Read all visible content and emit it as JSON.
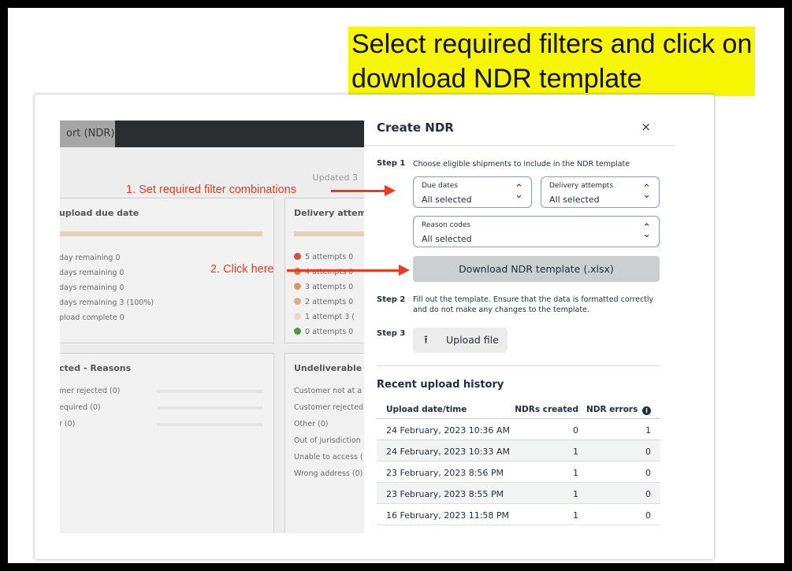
{
  "callout": {
    "line1": "Select required filters and click on",
    "line2": "download NDR template"
  },
  "background": {
    "tab": "ort (NDR)",
    "updated": "Updated 3",
    "card1": {
      "title": "upload due date",
      "rows": [
        "day remaining  0",
        "days remaining  0",
        "days remaining  0",
        "days remaining  3 (100%)",
        "pload complete  0"
      ]
    },
    "card2": {
      "title": "Delivery attemp",
      "rows": [
        {
          "label": "5 attempts  0",
          "color": "#c9553d"
        },
        {
          "label": "4 attempts  0",
          "color": "#d5784a"
        },
        {
          "label": "3 attempts  0",
          "color": "#d99a5b"
        },
        {
          "label": "2 attempts  0",
          "color": "#dbb082"
        },
        {
          "label": "1 attempt  3 (",
          "color": "#e8d9c6"
        },
        {
          "label": "0 attempts  0",
          "color": "#4e9a3a"
        }
      ]
    },
    "card3": {
      "title": "cted - Reasons",
      "rows": [
        "mer rejected (0)",
        "equired (0)",
        "r (0)"
      ]
    },
    "card4": {
      "title": "Undeliverable -",
      "rows": [
        "Customer not at a",
        "Customer rejected",
        "Other (0)",
        "Out of jurisdiction",
        "Unable to access (",
        "Wrong address (0)"
      ]
    }
  },
  "annotations": {
    "a1": "1. Set required filter combinations",
    "a2": "2. Click here"
  },
  "panel": {
    "title": "Create NDR",
    "close": "×",
    "step1": {
      "label": "Step 1",
      "text": "Choose eligible shipments to include in the NDR template"
    },
    "due_dates": {
      "label": "Due dates",
      "value": "All selected"
    },
    "delivery_attempts": {
      "label": "Delivery attempts",
      "value": "All selected"
    },
    "reason_codes": {
      "label": "Reason codes",
      "value": "All selected"
    },
    "chevron": "⌃⌄",
    "download_button": "Download NDR template (.xlsx)",
    "step2": {
      "label": "Step 2",
      "text1": "Fill out the template. Ensure that the data is formatted correctly",
      "text2": "and do not make any changes to the template."
    },
    "step3": {
      "label": "Step 3"
    },
    "upload_icon": "⭱",
    "upload_button": "Upload file",
    "history_title": "Recent upload history",
    "columns": {
      "date": "Upload date/time",
      "created": "NDRs created",
      "errors": "NDR errors",
      "info": "i"
    },
    "rows": [
      {
        "date": "24 February, 2023 10:36 AM",
        "created": "0",
        "errors": "1"
      },
      {
        "date": "24 February, 2023 10:33 AM",
        "created": "1",
        "errors": "0"
      },
      {
        "date": "23 February, 2023 8:56 PM",
        "created": "1",
        "errors": "0"
      },
      {
        "date": "23 February, 2023 8:55 PM",
        "created": "1",
        "errors": "0"
      },
      {
        "date": "16 February, 2023 11:58 PM",
        "created": "1",
        "errors": "0"
      }
    ]
  }
}
